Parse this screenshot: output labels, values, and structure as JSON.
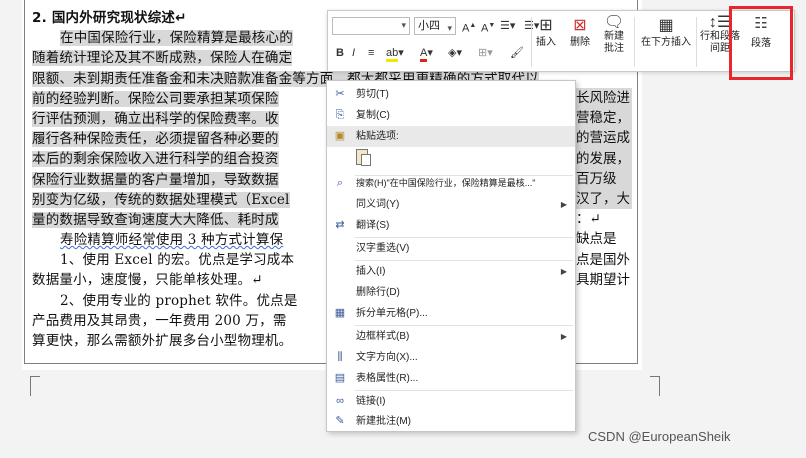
{
  "document": {
    "lines": [
      "2. 国内外研究现状综述↵",
      "在中国保险行业，保险精算是最核心的",
      "随着统计理论及其不断成熟，保险人在确定",
      "限额、未到期责任准备金和未决赔款准备金等方面，都大都采用更精确的方式取代以",
      "前的经验判断。保险公司要承担某项保险",
      "行评估预测，确立出科学的保险费率。收",
      "履行各种保险责任，必须提留各种必要的",
      "本后的剩余保险收入进行科学的组合投资",
      "保险行业数据量的客户量增加，导致数据",
      "别变为亿级，传统的数据处理模式（Excel",
      "量的数据导致查询速度大大降低、耗时成",
      "寿险精算师经常使用 3 种方式计算保",
      "1、使用 Excel 的宏。优点是学习成本",
      "数据量小，速度慢，只能单核处理。↵",
      "2、使用专业的 prophet 软件。优点是",
      "产品费用及其昂贵，一年费用 200 万，需",
      "算更快，那么需额外扩展多台小型物理机。"
    ],
    "right_fragments": [
      "长风险进",
      "营稳定，",
      "的营运成",
      "的发展，",
      "百万级",
      "汉了，大",
      "：↵",
      "缺点是",
      "点是国外",
      "具期望计"
    ]
  },
  "mini_toolbar": {
    "font_name": "",
    "font_size": "小四",
    "insert_label": "插入",
    "delete_label": "删除",
    "new_comment_label_1": "新建",
    "new_comment_label_2": "批注",
    "insert_below_label": "在下方插入",
    "row_spacing_label_1": "行和段落",
    "row_spacing_label_2": "间距",
    "paragraph_label": "段落"
  },
  "context_menu": {
    "items": [
      {
        "label": "剪切(T)",
        "icon": "scissors-icon",
        "glyph": "✂"
      },
      {
        "label": "复制(C)",
        "icon": "copy-icon",
        "glyph": "⎘"
      },
      {
        "label": "粘贴选项:",
        "icon": "paste-icon",
        "glyph": "📋"
      },
      {
        "label": "搜索(H)\"在中国保险行业，保险精算是最核...\"",
        "icon": "search-icon",
        "glyph": "⌕"
      },
      {
        "label": "同义词(Y)",
        "icon": "",
        "glyph": ""
      },
      {
        "label": "翻译(S)",
        "icon": "translate-icon",
        "glyph": "⇄"
      },
      {
        "label": "汉字重选(V)",
        "icon": "",
        "glyph": ""
      },
      {
        "label": "插入(I)",
        "icon": "",
        "glyph": ""
      },
      {
        "label": "删除行(D)",
        "icon": "",
        "glyph": ""
      },
      {
        "label": "拆分单元格(P)...",
        "icon": "split-cells-icon",
        "glyph": "▦"
      },
      {
        "label": "边框样式(B)",
        "icon": "",
        "glyph": ""
      },
      {
        "label": "文字方向(X)...",
        "icon": "text-direction-icon",
        "glyph": "⫼"
      },
      {
        "label": "表格属性(R)...",
        "icon": "table-properties-icon",
        "glyph": "▤"
      },
      {
        "label": "链接(I)",
        "icon": "link-icon",
        "glyph": "∞"
      },
      {
        "label": "新建批注(M)",
        "icon": "comment-icon",
        "glyph": "🗨"
      }
    ]
  },
  "watermark": "CSDN @EuropeanSheik"
}
